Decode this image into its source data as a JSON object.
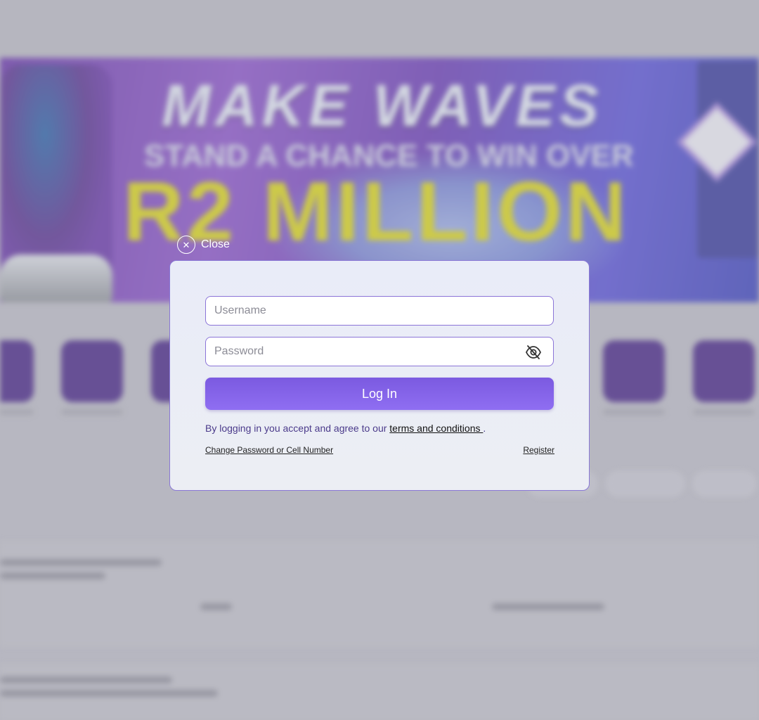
{
  "background": {
    "banner": {
      "line1": "MAKE WAVES",
      "line2": "STAND A CHANCE TO WIN OVER",
      "line3": "R2 MILLION"
    }
  },
  "modal": {
    "close_label": "Close",
    "close_icon": "x-circle-icon",
    "username_placeholder": "Username",
    "password_placeholder": "Password",
    "eye_icon": "eye-slash-icon",
    "login_label": "Log In",
    "terms_prefix": "By logging in you accept and agree to our ",
    "terms_link": "terms and conditions ",
    "terms_suffix": ".",
    "change_link": "Change Password or Cell Number",
    "register_link": "Register"
  },
  "colors": {
    "accent": "#8b74d8",
    "button": "#8565ea",
    "banner_yellow": "#d6d21d"
  }
}
